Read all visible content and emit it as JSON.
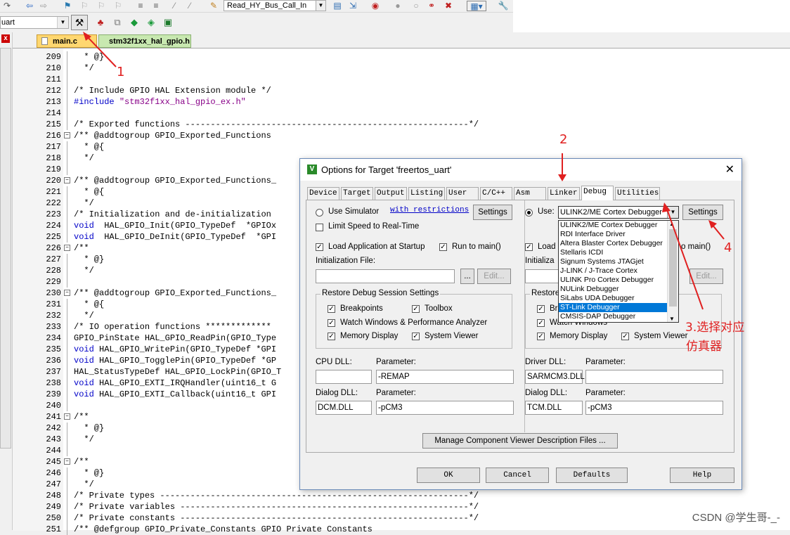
{
  "toolbar": {
    "function_combo": "Read_HY_Bus_Call_In",
    "target": "uart"
  },
  "file_tabs": [
    {
      "label": "main.c"
    },
    {
      "label": "stm32f1xx_hal_gpio.h"
    }
  ],
  "code_lines": [
    {
      "num": "209",
      "text": "  * @}"
    },
    {
      "num": "210",
      "text": "  */"
    },
    {
      "num": "211",
      "text": ""
    },
    {
      "num": "212",
      "text": "/* Include GPIO HAL Extension module */"
    },
    {
      "num": "213",
      "text": "#include \"stm32f1xx_hal_gpio_ex.h\""
    },
    {
      "num": "214",
      "text": ""
    },
    {
      "num": "215",
      "text": "/* Exported functions --------------------------------------------------------*/"
    },
    {
      "num": "216",
      "text": "/** @addtogroup GPIO_Exported_Functions"
    },
    {
      "num": "217",
      "text": "  * @{"
    },
    {
      "num": "218",
      "text": "  */"
    },
    {
      "num": "219",
      "text": ""
    },
    {
      "num": "220",
      "text": "/** @addtogroup GPIO_Exported_Functions_"
    },
    {
      "num": "221",
      "text": "  * @{"
    },
    {
      "num": "222",
      "text": "  */"
    },
    {
      "num": "223",
      "text": "/* Initialization and de-initialization"
    },
    {
      "num": "224",
      "text": "void  HAL_GPIO_Init(GPIO_TypeDef  *GPIOx"
    },
    {
      "num": "225",
      "text": "void  HAL_GPIO_DeInit(GPIO_TypeDef  *GPI"
    },
    {
      "num": "226",
      "text": "/**"
    },
    {
      "num": "227",
      "text": "  * @}"
    },
    {
      "num": "228",
      "text": "  */"
    },
    {
      "num": "229",
      "text": ""
    },
    {
      "num": "230",
      "text": "/** @addtogroup GPIO_Exported_Functions_"
    },
    {
      "num": "231",
      "text": "  * @{"
    },
    {
      "num": "232",
      "text": "  */"
    },
    {
      "num": "233",
      "text": "/* IO operation functions *************"
    },
    {
      "num": "234",
      "text": "GPIO_PinState HAL_GPIO_ReadPin(GPIO_Type"
    },
    {
      "num": "235",
      "text": "void HAL_GPIO_WritePin(GPIO_TypeDef *GPI"
    },
    {
      "num": "236",
      "text": "void HAL_GPIO_TogglePin(GPIO_TypeDef *GP"
    },
    {
      "num": "237",
      "text": "HAL_StatusTypeDef HAL_GPIO_LockPin(GPIO_T"
    },
    {
      "num": "238",
      "text": "void HAL_GPIO_EXTI_IRQHandler(uint16_t G"
    },
    {
      "num": "239",
      "text": "void HAL_GPIO_EXTI_Callback(uint16_t GPI"
    },
    {
      "num": "240",
      "text": ""
    },
    {
      "num": "241",
      "text": "/**"
    },
    {
      "num": "242",
      "text": "  * @}"
    },
    {
      "num": "243",
      "text": "  */"
    },
    {
      "num": "244",
      "text": ""
    },
    {
      "num": "245",
      "text": "/**"
    },
    {
      "num": "246",
      "text": "  * @}"
    },
    {
      "num": "247",
      "text": "  */"
    },
    {
      "num": "248",
      "text": "/* Private types -------------------------------------------------------------*/"
    },
    {
      "num": "249",
      "text": "/* Private variables ---------------------------------------------------------*/"
    },
    {
      "num": "250",
      "text": "/* Private constants ---------------------------------------------------------*/"
    },
    {
      "num": "251",
      "text": "/** @defgroup GPIO_Private_Constants GPIO Private Constants"
    }
  ],
  "annotations": {
    "a1": "1",
    "a2": "2",
    "a3_line1": "3.选择对应",
    "a3_line2": "仿真器",
    "a4": "4"
  },
  "dialog": {
    "title": "Options for Target 'freertos_uart'",
    "close": "✕",
    "tabs": [
      "Device",
      "Target",
      "Output",
      "Listing",
      "User",
      "C/C++",
      "Asm",
      "Linker",
      "Debug",
      "Utilities"
    ],
    "left": {
      "use_simulator": "Use Simulator",
      "with_restrictions": "with restrictions",
      "settings": "Settings",
      "limit_speed": "Limit Speed to Real-Time",
      "load_app": "Load Application at Startup",
      "run_to_main": "Run to main()",
      "init_file": "Initialization File:",
      "browse": "...",
      "edit": "Edit...",
      "restore_title": "Restore Debug Session Settings",
      "breakpoints": "Breakpoints",
      "toolbox": "Toolbox",
      "watch": "Watch Windows & Performance Analyzer",
      "memory": "Memory Display",
      "system_viewer": "System Viewer",
      "cpu_dll": "CPU DLL:",
      "parameter": "Parameter:",
      "cpu_dll_value": "",
      "cpu_param_value": "-REMAP",
      "dialog_dll": "Dialog DLL:",
      "dialog_dll_value": "DCM.DLL",
      "dialog_param_value": "-pCM3"
    },
    "right": {
      "use": "Use:",
      "debugger_selected": "ULINK2/ME Cortex Debugger",
      "settings": "Settings",
      "load": "Load",
      "to_main": "o main()",
      "init_file": "Initializa",
      "edit": "Edit...",
      "restore": "Restore",
      "brea": "Brea",
      "watch_windows": "Watch Windows",
      "memory": "Memory Display",
      "system_viewer": "System Viewer",
      "driver_dll": "Driver DLL:",
      "parameter": "Parameter:",
      "driver_dll_value": "SARMCM3.DLL",
      "dialog_dll": "Dialog DLL:",
      "dialog_dll_value": "TCM.DLL",
      "dialog_param_value": "-pCM3"
    },
    "debugger_options": [
      "ULINK2/ME Cortex Debugger",
      "RDI Interface Driver",
      "Altera Blaster Cortex Debugger",
      "Stellaris ICDI",
      "Signum Systems JTAGjet",
      "J-LINK / J-Trace Cortex",
      "ULINK Pro Cortex Debugger",
      "NULink Debugger",
      "SiLabs UDA Debugger",
      "ST-Link Debugger",
      "CMSIS-DAP Debugger"
    ],
    "manage_btn": "Manage Component Viewer Description Files ...",
    "ok": "OK",
    "cancel": "Cancel",
    "defaults": "Defaults",
    "help": "Help"
  },
  "watermark": "CSDN @学生哥-_-"
}
